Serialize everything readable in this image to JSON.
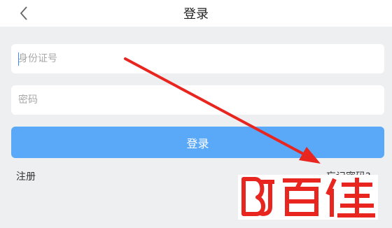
{
  "header": {
    "title": "登录",
    "back_icon": "chevron-left-icon"
  },
  "form": {
    "id_placeholder": "身份证号",
    "password_placeholder": "密码",
    "login_label": "登录",
    "register_label": "注册",
    "forgot_label": "忘记密码?"
  },
  "watermark": {
    "text": "BJ百佳"
  },
  "colors": {
    "primary": "#5aa8f8",
    "arrow": "#e8261f",
    "watermark": "#e8261f"
  }
}
